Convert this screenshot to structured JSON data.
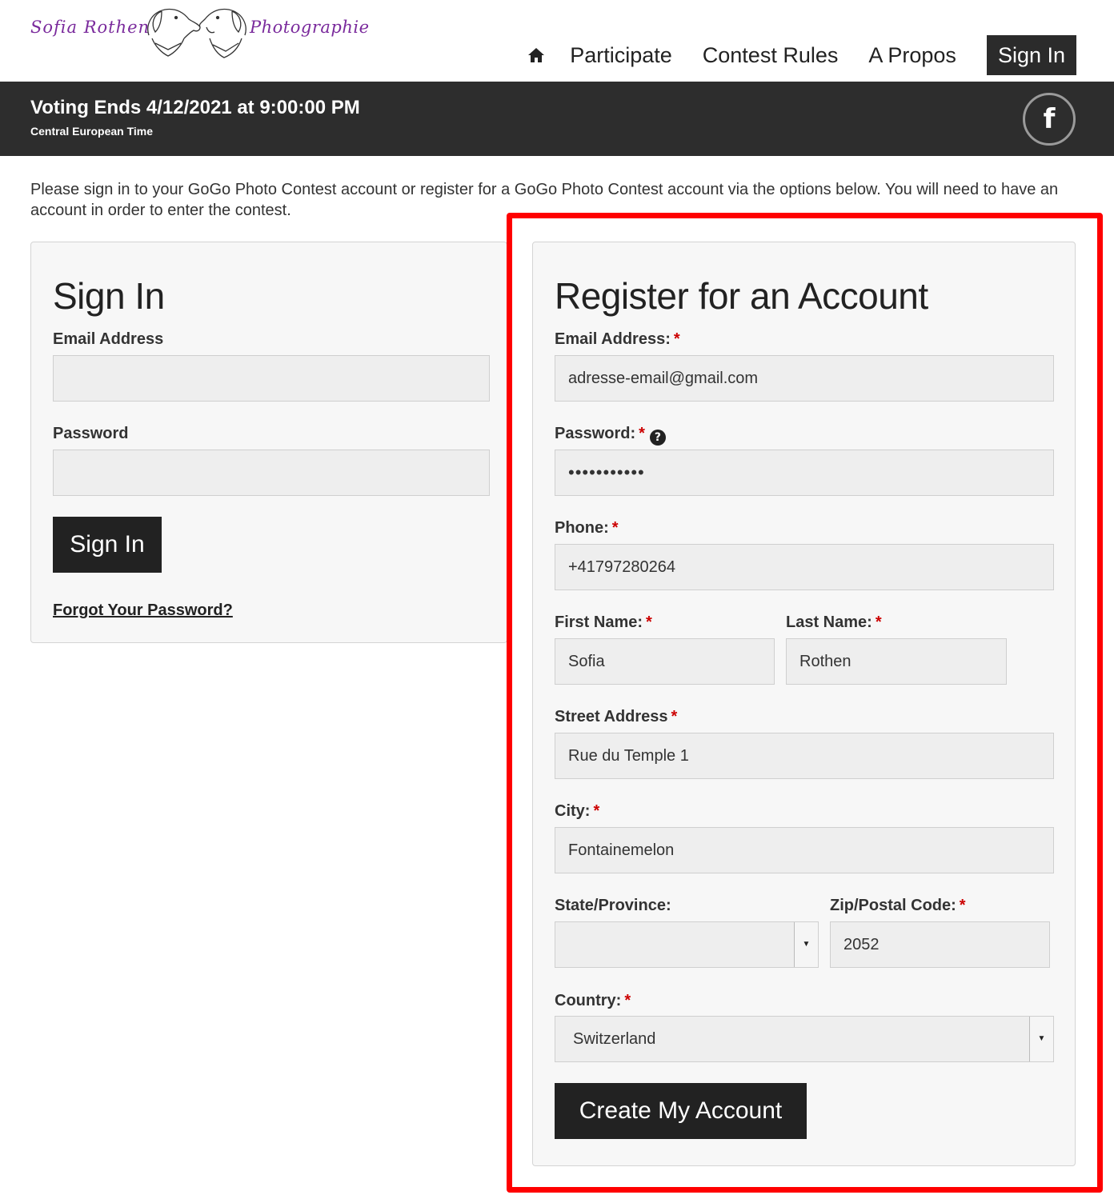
{
  "brand": {
    "logo_left": "Sofia Rothen",
    "logo_right": "Photographie"
  },
  "nav": {
    "home_icon": "home-icon",
    "items": [
      "Participate",
      "Contest Rules",
      "A Propos"
    ],
    "signin": "Sign In"
  },
  "banner": {
    "title": "Voting Ends 4/12/2021 at 9:00:00 PM",
    "subtitle": "Central European Time",
    "facebook_icon": "facebook-icon",
    "facebook_glyph": "f"
  },
  "intro": "Please sign in to your GoGo Photo Contest account or register for a GoGo Photo Contest account via the options below. You will need to have an account in order to enter the contest.",
  "signin": {
    "title": "Sign In",
    "email_label": "Email Address",
    "email_value": "",
    "password_label": "Password",
    "password_value": "",
    "button": "Sign In",
    "forgot": "Forgot Your Password?"
  },
  "register": {
    "title": "Register for an Account",
    "required_mark": "*",
    "email_label": "Email Address:",
    "email_value": "adresse-email@gmail.com",
    "password_label": "Password:",
    "password_help_glyph": "?",
    "password_value": "•••••••••••",
    "phone_label": "Phone:",
    "phone_value": "+41797280264",
    "first_name_label": "First Name:",
    "first_name_value": "Sofia",
    "last_name_label": "Last Name:",
    "last_name_value": "Rothen",
    "street_label": "Street Address",
    "street_value": "Rue du Temple 1",
    "city_label": "City:",
    "city_value": "Fontainemelon",
    "state_label": "State/Province:",
    "state_value": "",
    "zip_label": "Zip/Postal Code:",
    "zip_value": "2052",
    "country_label": "Country:",
    "country_value": "Switzerland",
    "select_arrow_glyph": "▼",
    "button": "Create My Account"
  },
  "colors": {
    "banner_bg": "#2d2d2d",
    "button_bg": "#222222",
    "required": "#cc0000",
    "highlight": "#ff0000",
    "logo_text": "#7a2a9c"
  }
}
